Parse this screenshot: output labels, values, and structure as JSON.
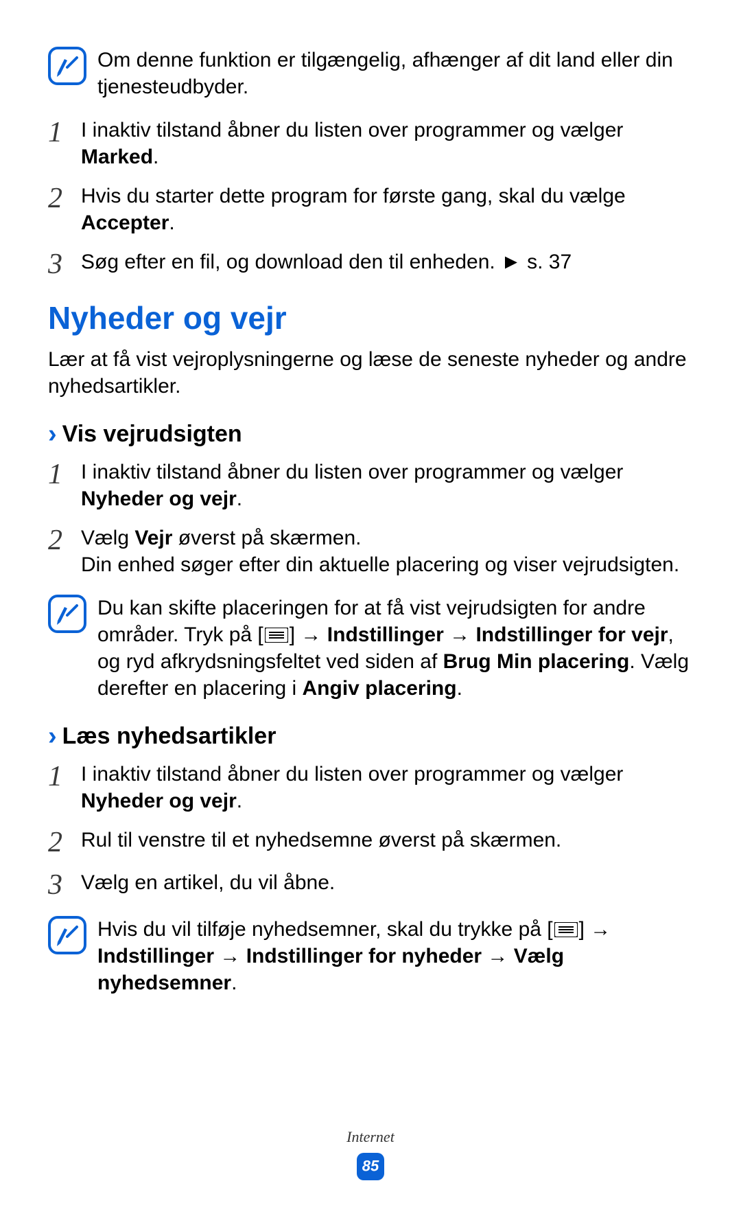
{
  "note_top": "Om denne funktion er tilgængelig, afhænger af dit land eller din tjenesteudbyder.",
  "steps_top": [
    {
      "pre": "I inaktiv tilstand åbner du listen over programmer og vælger ",
      "bold": "Marked",
      "post": "."
    },
    {
      "pre": "Hvis du starter dette program for første gang, skal du vælge ",
      "bold": "Accepter",
      "post": "."
    },
    {
      "pre": "Søg efter en fil, og download den til enheden. ► s. 37",
      "bold": "",
      "post": ""
    }
  ],
  "section_title": "Nyheder og vejr",
  "section_desc": "Lær at få vist vejroplysningerne og læse de seneste nyheder og andre nyhedsartikler.",
  "sub1_title": "Vis vejrudsigten",
  "steps_sub1": [
    {
      "pre": "I inaktiv tilstand åbner du listen over programmer og vælger ",
      "bold": "Nyheder og vejr",
      "post": "."
    },
    {
      "pre": "Vælg ",
      "bold": "Vejr",
      "post": " øverst på skærmen.",
      "extra": "Din enhed søger efter din aktuelle placering og viser vejrudsigten."
    }
  ],
  "note_mid": {
    "t1": "Du kan skifte placeringen for at få vist vejrudsigten for andre områder. Tryk på [",
    "t2": "] → ",
    "b1": "Indstillinger",
    "t3": " → ",
    "b2": "Indstillinger for vejr",
    "t4": ", og ryd afkrydsningsfeltet ved siden af ",
    "b3": "Brug Min placering",
    "t5": ". Vælg derefter en placering i ",
    "b4": "Angiv placering",
    "t6": "."
  },
  "sub2_title": "Læs nyhedsartikler",
  "steps_sub2": [
    {
      "pre": "I inaktiv tilstand åbner du listen over programmer og vælger ",
      "bold": "Nyheder og vejr",
      "post": "."
    },
    {
      "pre": "Rul til venstre til et nyhedsemne øverst på skærmen.",
      "bold": "",
      "post": ""
    },
    {
      "pre": "Vælg en artikel, du vil åbne.",
      "bold": "",
      "post": ""
    }
  ],
  "note_bottom": {
    "t1": "Hvis du vil tilføje nyhedsemner, skal du trykke på [",
    "t2": "] → ",
    "b1": "Indstillinger",
    "t3": " → ",
    "b2": "Indstillinger for nyheder",
    "t4": " → ",
    "b3": "Vælg nyhedsemner",
    "t5": "."
  },
  "footer_label": "Internet",
  "page_number": "85"
}
